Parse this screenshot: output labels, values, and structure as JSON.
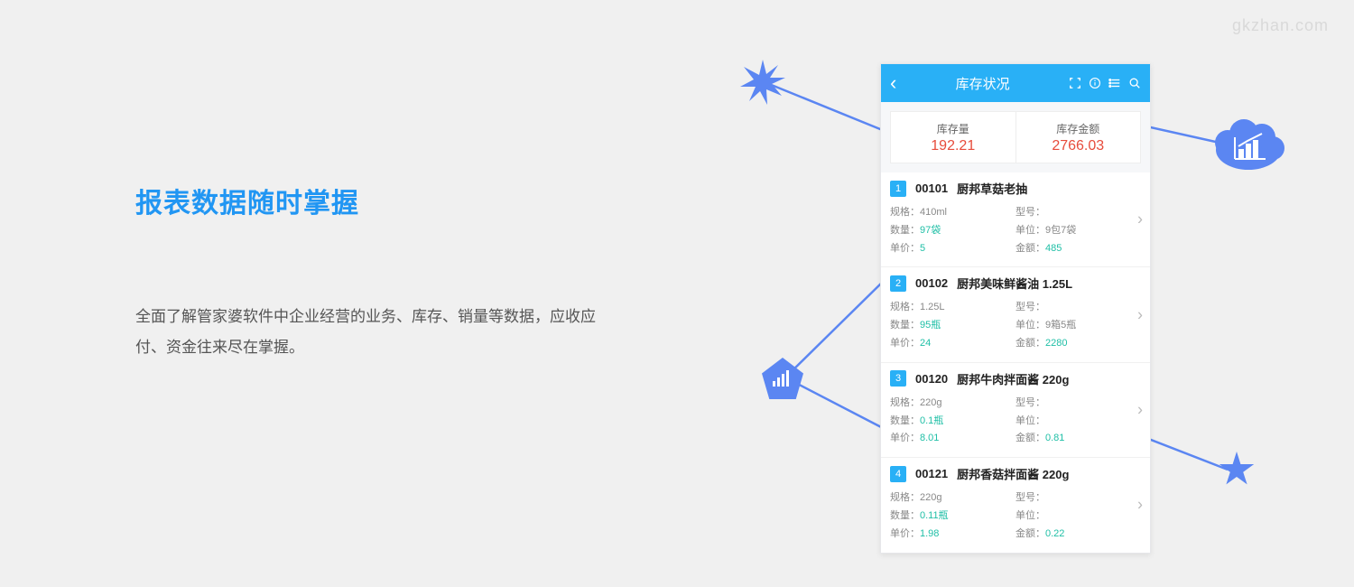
{
  "watermark": "gkzhan.com",
  "left": {
    "heading": "报表数据随时掌握",
    "paragraph": "全面了解管家婆软件中企业经营的业务、库存、销量等数据，应收应付、资金往来尽在掌握。"
  },
  "phone": {
    "header": {
      "title": "库存状况"
    },
    "summary": {
      "left_label": "库存量",
      "left_value": "192.21",
      "right_label": "库存金额",
      "right_value": "2766.03"
    },
    "labels": {
      "spec": "规格：",
      "model": "型号：",
      "qty": "数量：",
      "unit": "单位：",
      "price": "单价：",
      "amount": "金额："
    },
    "items": [
      {
        "idx": "1",
        "code": "00101",
        "name": "厨邦草菇老抽",
        "spec": "410ml",
        "model": "",
        "qty": "97袋",
        "unit": "9包7袋",
        "price": "5",
        "amount": "485"
      },
      {
        "idx": "2",
        "code": "00102",
        "name": "厨邦美味鲜酱油 1.25L",
        "spec": "1.25L",
        "model": "",
        "qty": "95瓶",
        "unit": "9箱5瓶",
        "price": "24",
        "amount": "2280"
      },
      {
        "idx": "3",
        "code": "00120",
        "name": "厨邦牛肉拌面酱 220g",
        "spec": "220g",
        "model": "",
        "qty": "0.1瓶",
        "unit": "",
        "price": "8.01",
        "amount": "0.81"
      },
      {
        "idx": "4",
        "code": "00121",
        "name": "厨邦香菇拌面酱 220g",
        "spec": "220g",
        "model": "",
        "qty": "0.11瓶",
        "unit": "",
        "price": "1.98",
        "amount": "0.22"
      }
    ]
  }
}
